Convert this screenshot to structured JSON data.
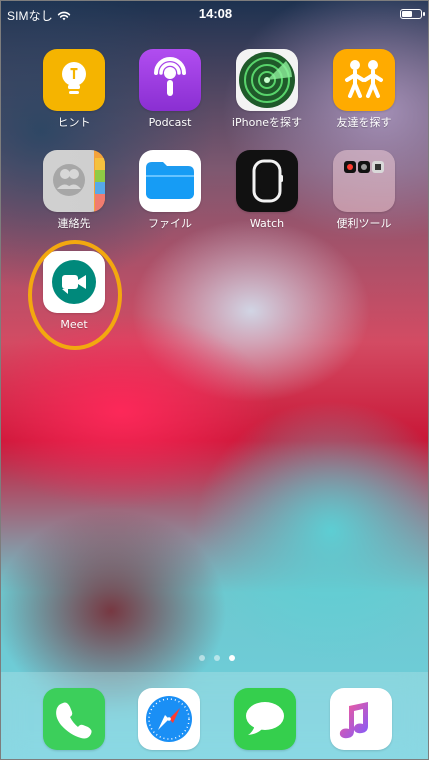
{
  "status_bar": {
    "carrier": "SIMなし",
    "time": "14:08"
  },
  "home": {
    "apps": [
      {
        "name": "ヒント",
        "icon": "tips-icon"
      },
      {
        "name": "Podcast",
        "icon": "podcast-icon"
      },
      {
        "name": "iPhoneを探す",
        "icon": "find-iphone-icon"
      },
      {
        "name": "友達を探す",
        "icon": "find-friends-icon"
      },
      {
        "name": "連絡先",
        "icon": "contacts-icon"
      },
      {
        "name": "ファイル",
        "icon": "files-icon"
      },
      {
        "name": "Watch",
        "icon": "watch-icon"
      },
      {
        "name": "便利ツール",
        "icon": "utilities-folder-icon"
      },
      {
        "name": "Meet",
        "icon": "meet-icon"
      }
    ],
    "page_indicator": {
      "pages": 3,
      "active_index": 2
    }
  },
  "dock": {
    "apps": [
      {
        "icon": "phone-icon"
      },
      {
        "icon": "safari-icon"
      },
      {
        "icon": "messages-icon"
      },
      {
        "icon": "music-icon"
      }
    ]
  },
  "colors": {
    "highlight": "#f3a80f",
    "meet_green": "#00897b",
    "podcast_purple": "#8e35d5",
    "files_blue": "#1994f5"
  }
}
